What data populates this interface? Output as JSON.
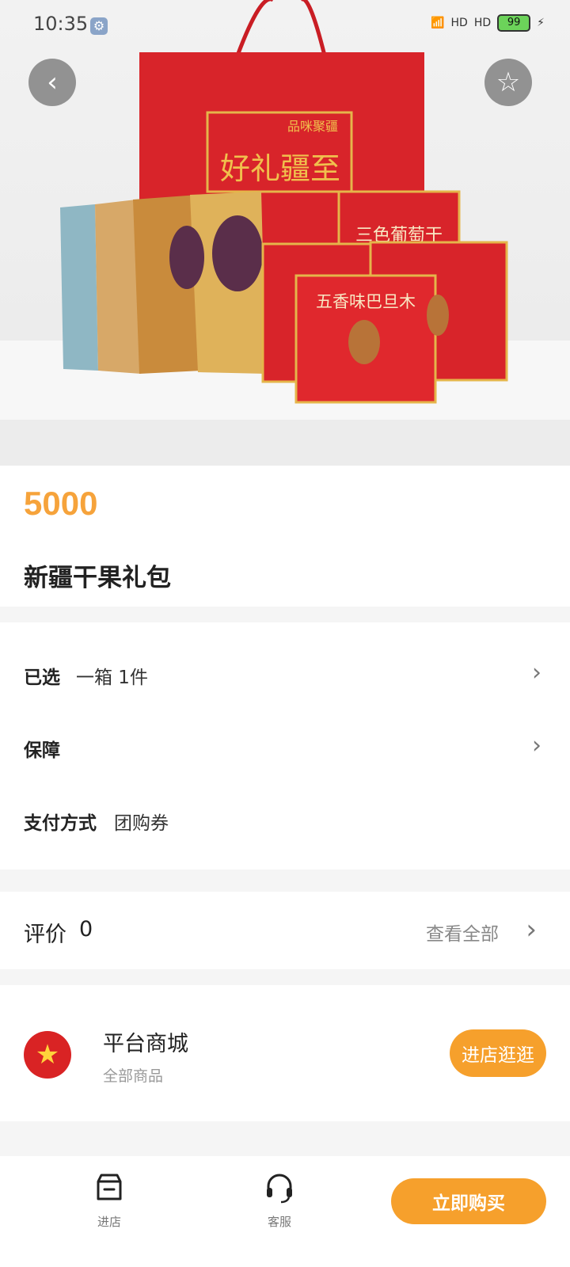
{
  "status_bar": {
    "time": "10:35",
    "battery": "99",
    "net_1": "HD",
    "net_2": "HD"
  },
  "product": {
    "price": "5000",
    "title": "新疆干果礼包"
  },
  "hero_text": {
    "bag_title": "好礼疆至",
    "brand": "品咪聚疆",
    "pack_1": "三色葡萄干",
    "pack_2": "五香味巴旦木"
  },
  "options": {
    "selected_label": "已选",
    "selected_value": "一箱 1件",
    "guarantee_label": "保障",
    "payment_label": "支付方式",
    "payment_value": "团购券"
  },
  "reviews": {
    "label": "评价",
    "count": "0",
    "see_all": "查看全部"
  },
  "shop": {
    "name": "平台商城",
    "subtitle": "全部商品",
    "button": "进店逛逛"
  },
  "bottom_bar": {
    "store_label": "进店",
    "service_label": "客服",
    "buy_label": "立即购买"
  },
  "colors": {
    "accent": "#f6a02c",
    "price": "#f6a33b",
    "bag_red": "#d8242a"
  },
  "icons": [
    "back-icon",
    "star-icon",
    "chevron-right-icon",
    "store-icon",
    "headset-icon",
    "settings-icon"
  ]
}
